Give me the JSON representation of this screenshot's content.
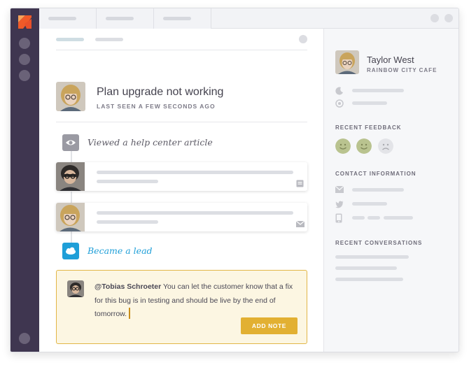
{
  "ticket": {
    "title": "Plan upgrade not working",
    "last_seen": "LAST SEEN A FEW SECONDS AGO"
  },
  "timeline": {
    "viewed_article": "Viewed a help center article",
    "became_lead": "Became a lead"
  },
  "note": {
    "mention": "@Tobias Schroeter",
    "text": " You can let the customer know that a fix for this bug is in testing and should be live by the end of tomorrow.",
    "add_note_label": "ADD NOTE"
  },
  "customer": {
    "name": "Taylor West",
    "company": "RAINBOW CITY CAFE"
  },
  "sections": {
    "recent_feedback": "RECENT FEEDBACK",
    "contact_information": "CONTACT INFORMATION",
    "recent_conversations": "RECENT CONVERSATIONS"
  },
  "icons": {
    "logo": "kayako-logo-icon",
    "eye": "eye-icon",
    "salesforce": "salesforce-cloud-icon",
    "mail": "mail-icon",
    "twitter": "twitter-icon",
    "phone": "phone-icon"
  },
  "colors": {
    "sidebar": "#3f3650",
    "accent_orange": "#f05a28",
    "note_border": "#e2b647",
    "add_note_button": "#e2b032",
    "lead_blue": "#1f9fd8",
    "feedback_happy": "#b9c38f"
  }
}
